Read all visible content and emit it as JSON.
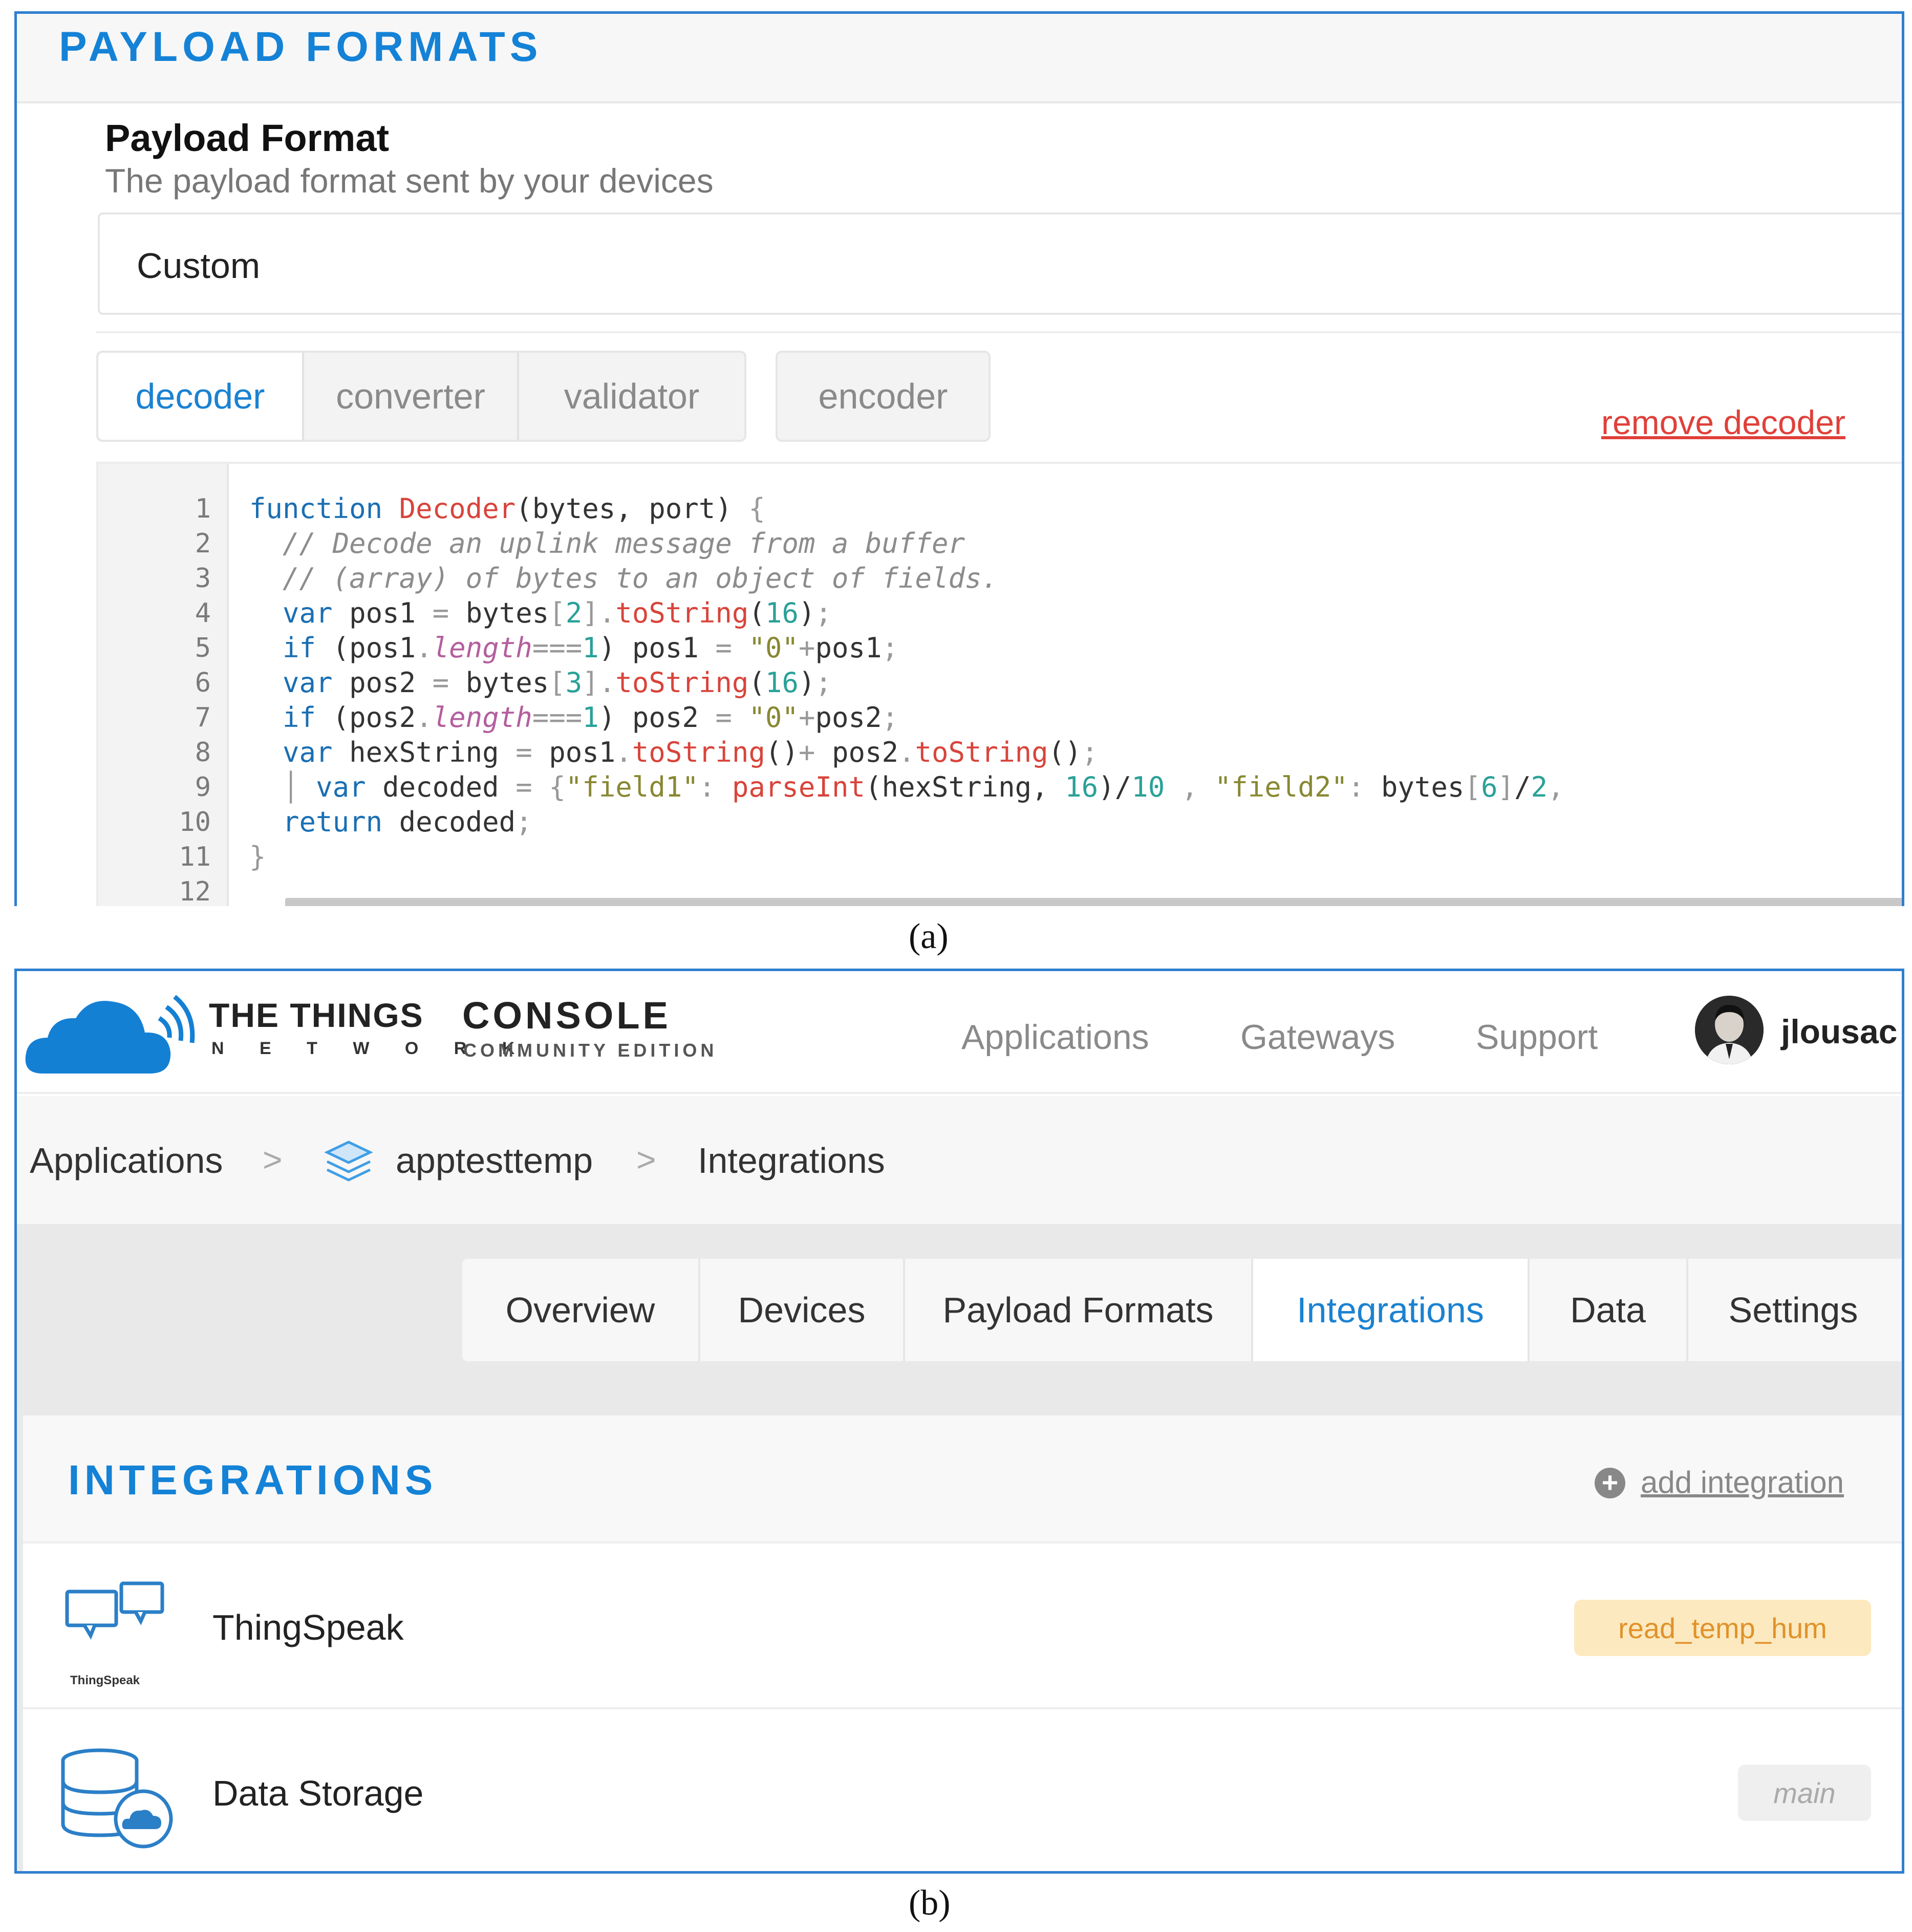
{
  "panel_a": {
    "header_title": "PAYLOAD FORMATS",
    "payload_format_title": "Payload Format",
    "payload_format_subtitle": "The payload format sent by your devices",
    "selected_format": "Custom",
    "tabs": [
      "decoder",
      "converter",
      "validator"
    ],
    "encoder_tab": "encoder",
    "remove_label": "remove decoder",
    "line_numbers": [
      "1",
      "2",
      "3",
      "4",
      "5",
      "6",
      "7",
      "8",
      "9",
      "10",
      "11",
      "12"
    ]
  },
  "caption_a": "(a)",
  "panel_b": {
    "brand_main": "THE THINGS",
    "brand_sub": "N E T W O R K",
    "console_title": "CONSOLE",
    "console_sub": "COMMUNITY EDITION",
    "nav": [
      "Applications",
      "Gateways",
      "Support"
    ],
    "username": "jlousac",
    "breadcrumb": [
      "Applications",
      "apptesttemp",
      "Integrations"
    ],
    "tabs": [
      "Overview",
      "Devices",
      "Payload Formats",
      "Integrations",
      "Data",
      "Settings"
    ],
    "section_title": "INTEGRATIONS",
    "add_label": "add integration",
    "thingspeak_logo_text": "ThingSpeak",
    "integrations": [
      {
        "name": "ThingSpeak",
        "badge": "read_temp_hum"
      },
      {
        "name": "Data Storage",
        "badge": "main"
      }
    ]
  },
  "caption_b": "(b)",
  "colors": {
    "accent_blue": "#1482d6",
    "remove_red": "#e0403a",
    "badge_orange_bg": "#fde9bf",
    "badge_orange_text": "#e0922a"
  }
}
